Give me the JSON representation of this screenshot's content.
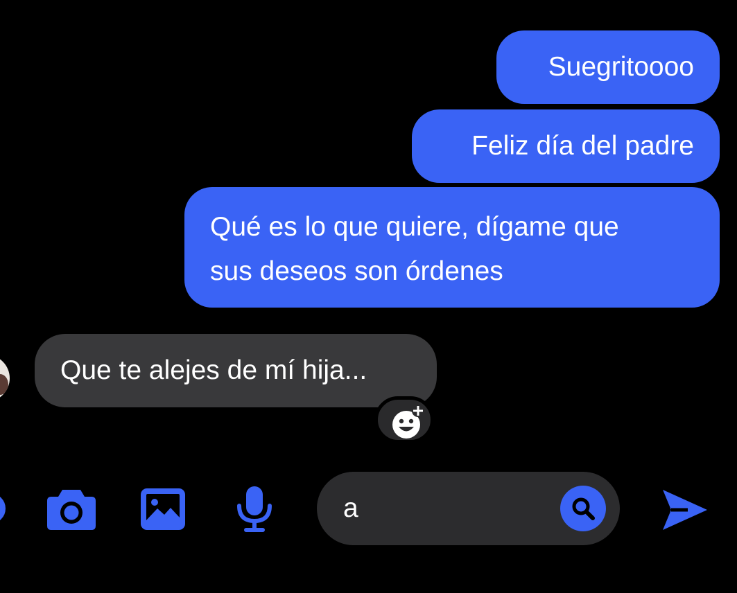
{
  "colors": {
    "background": "#000000",
    "outgoing_bubble": "#3a63f5",
    "incoming_bubble": "#39393b",
    "accent": "#3a63f5",
    "composer": "#2c2c2e"
  },
  "messages": [
    {
      "direction": "outgoing",
      "text": "Suegritoooo"
    },
    {
      "direction": "outgoing",
      "text": "Feliz día del padre"
    },
    {
      "direction": "outgoing",
      "lines": [
        "Qué es lo que quiere, dígame que",
        "sus deseos son órdenes"
      ]
    },
    {
      "direction": "incoming",
      "text": "Que te alejes de mí hija..."
    }
  ],
  "composer": {
    "value": "a"
  },
  "icons": {
    "react": "add-reaction-icon",
    "camera": "camera-icon",
    "gallery": "image-icon",
    "mic": "microphone-icon",
    "search": "search-icon",
    "send": "send-icon"
  }
}
